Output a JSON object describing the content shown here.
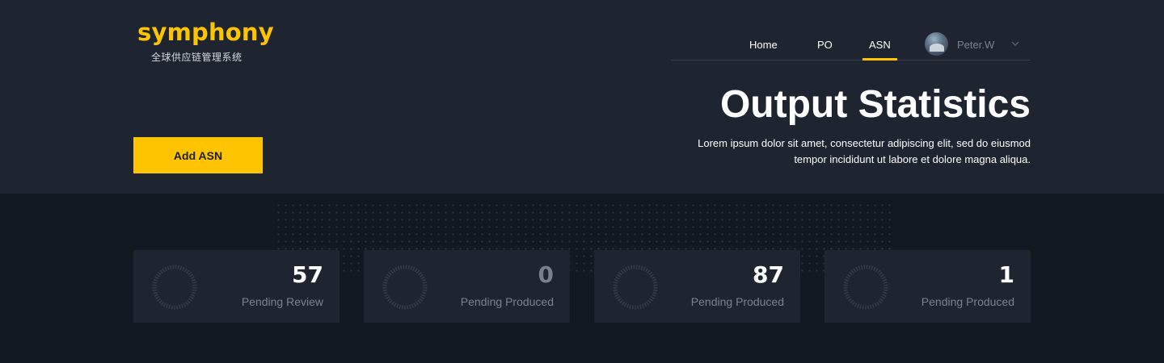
{
  "brand": {
    "name": "symphony",
    "tagline": "全球供应链管理系统",
    "accent_color": "#ffc400"
  },
  "nav": {
    "items": [
      {
        "label": "Home",
        "active": false
      },
      {
        "label": "PO",
        "active": false
      },
      {
        "label": "ASN",
        "active": true
      }
    ],
    "user": {
      "name": "Peter.W",
      "avatar_icon": "avatar",
      "menu_icon": "chevron-down-icon"
    }
  },
  "hero": {
    "title": "Output Statistics",
    "description": "Lorem ipsum dolor sit amet, consectetur adipiscing elit, sed do eiusmod tempor incididunt ut labore et dolore magna aliqua.",
    "add_button_label": "Add ASN"
  },
  "stats": [
    {
      "value": "57",
      "label": "Pending Review"
    },
    {
      "value": "0",
      "label": "Pending Produced"
    },
    {
      "value": "87",
      "label": "Pending Produced"
    },
    {
      "value": "1",
      "label": "Pending Produced"
    }
  ]
}
